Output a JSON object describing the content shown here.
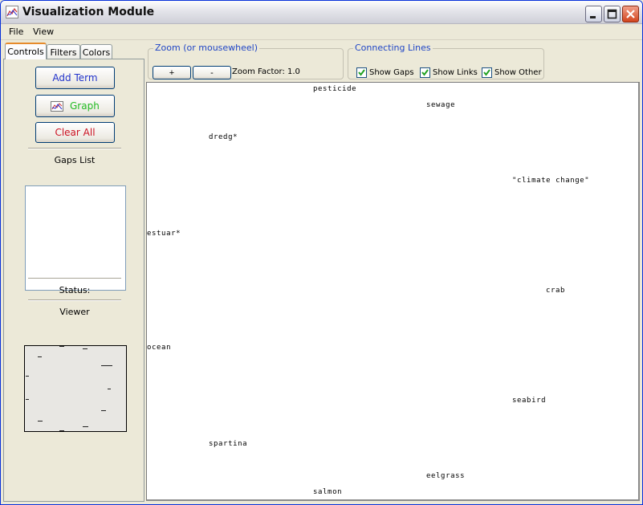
{
  "window": {
    "title": "Visualization Module"
  },
  "menu": {
    "items": [
      "File",
      "View"
    ]
  },
  "tabs": [
    "Controls",
    "Filters",
    "Colors"
  ],
  "controls": {
    "add_term": "Add Term",
    "graph": "Graph",
    "clear_all": "Clear All",
    "gaps_list_label": "Gaps List",
    "status_label": "Status:",
    "viewer_label": "Viewer"
  },
  "zoom": {
    "title": "Zoom (or mousewheel)",
    "plus": "+",
    "minus": "-",
    "factor_label": "Zoom Factor: 1.0"
  },
  "connecting_lines": {
    "title": "Connecting Lines",
    "options": [
      {
        "label": "Show Gaps",
        "checked": true
      },
      {
        "label": "Show Links",
        "checked": true
      },
      {
        "label": "Show Other",
        "checked": true
      }
    ]
  },
  "terms": [
    "pesticide",
    "sewage",
    "dredg*",
    "\"climate change\"",
    "estuar*",
    "crab",
    "ocean",
    "seabird",
    "spartina",
    "eelgrass",
    "salmon"
  ],
  "colors": {
    "accent_blue": "#1f45c6",
    "add_term": "#2233cc",
    "graph": "#22bb22",
    "clear_all": "#cc1122"
  }
}
